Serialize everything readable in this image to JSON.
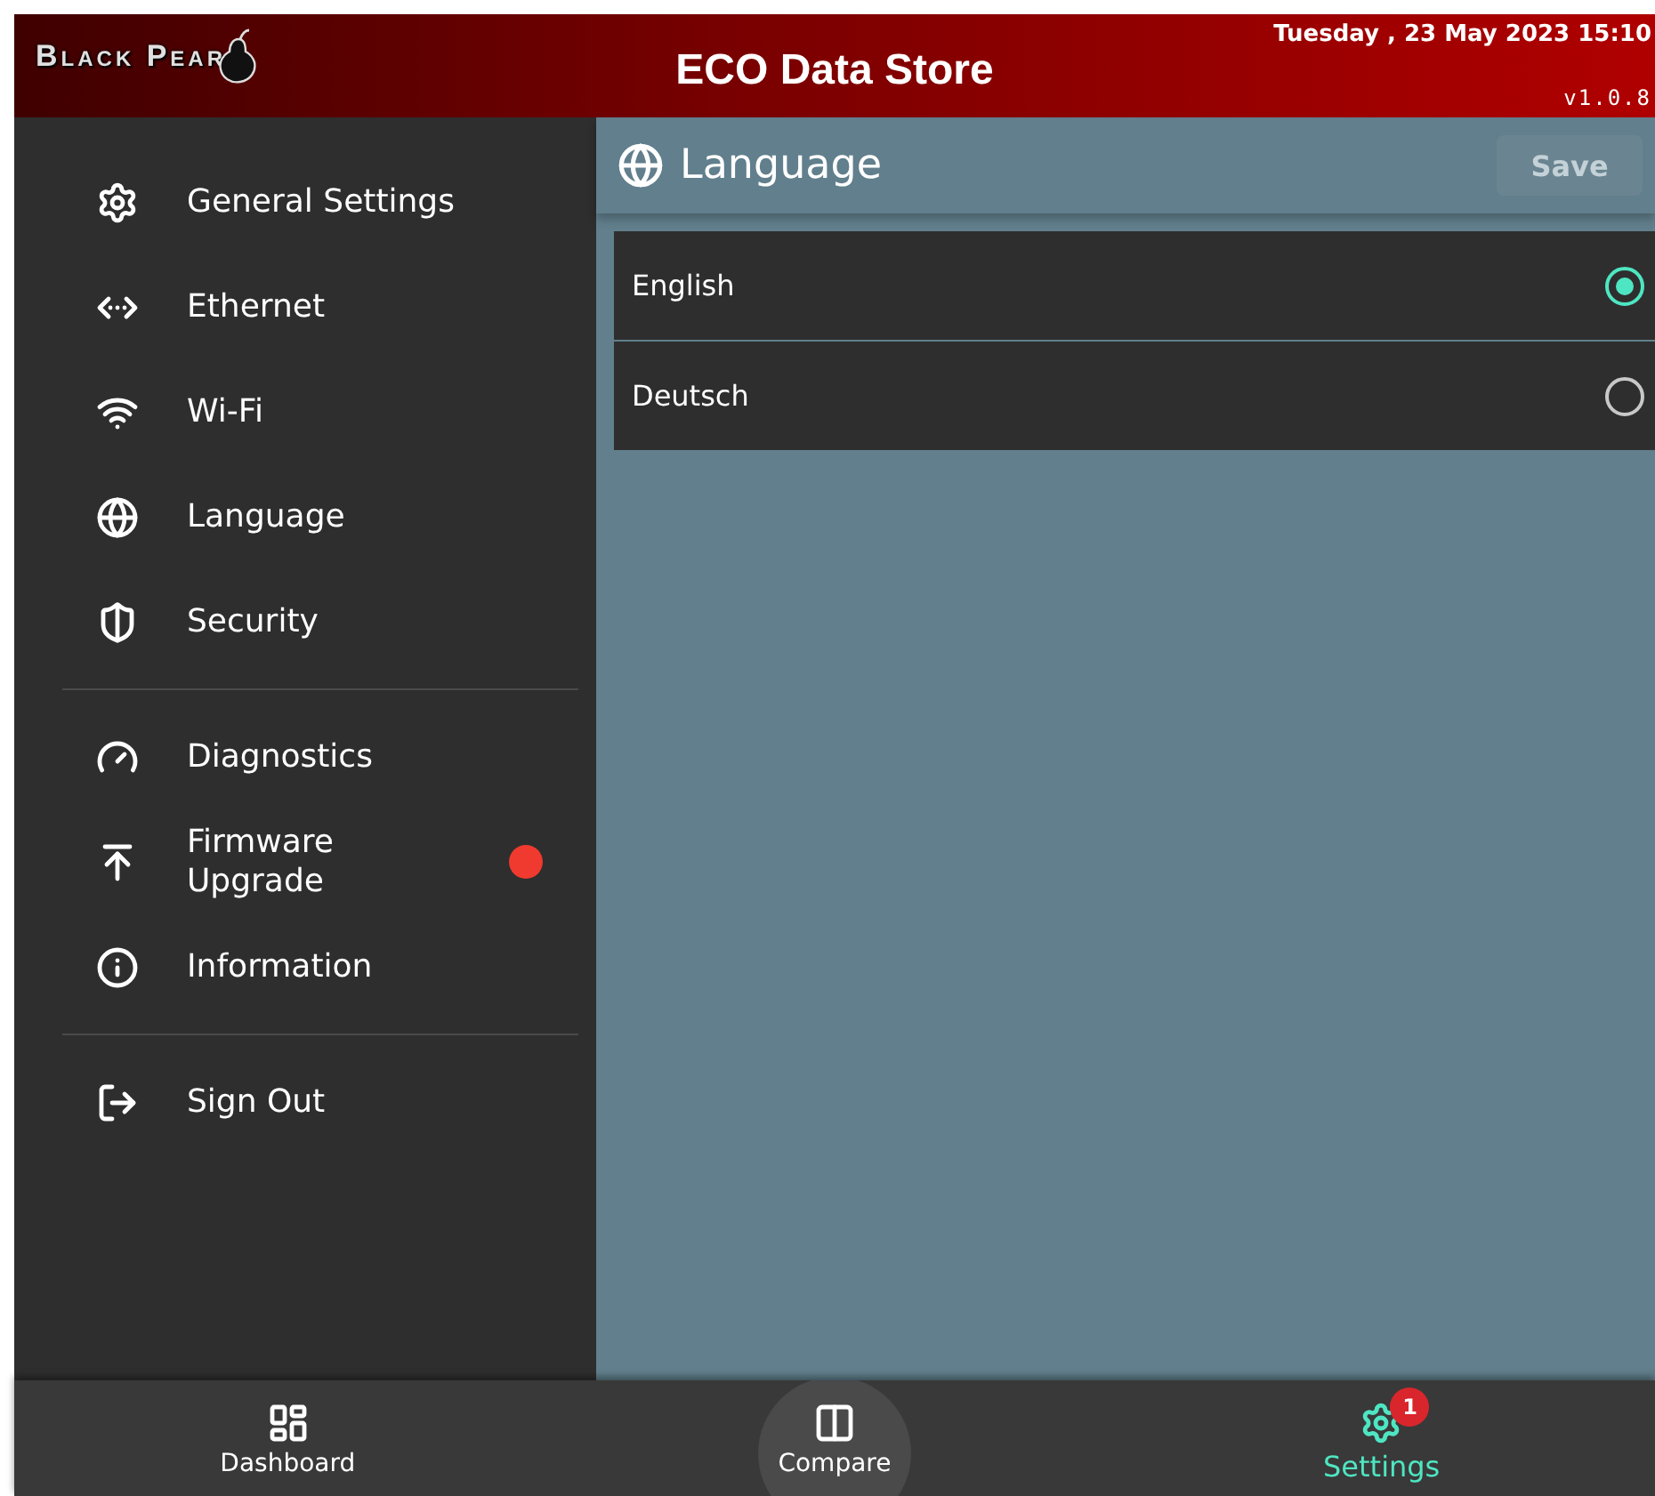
{
  "header": {
    "logo": "Black Pear",
    "title": "ECO Data Store",
    "datetime": "Tuesday , 23 May 2023 15:10",
    "version": "v1.0.8"
  },
  "sidebar": {
    "sections": [
      {
        "items": [
          {
            "label": "General  Settings",
            "alert": false
          },
          {
            "label": "Ethernet",
            "alert": false
          },
          {
            "label": "Wi-Fi",
            "alert": false
          },
          {
            "label": "Language",
            "alert": false
          },
          {
            "label": "Security",
            "alert": false
          }
        ]
      },
      {
        "items": [
          {
            "label": "Diagnostics",
            "alert": false
          },
          {
            "label": "Firmware\nUpgrade",
            "alert": true
          },
          {
            "label": "Information",
            "alert": false
          }
        ]
      },
      {
        "items": [
          {
            "label": "Sign  Out",
            "alert": false
          }
        ]
      }
    ]
  },
  "panel": {
    "title": "Language",
    "save_button": {
      "label": "Save",
      "disabled": true
    },
    "options": [
      {
        "label": "English",
        "selected": true
      },
      {
        "label": "Deutsch",
        "selected": false
      }
    ]
  },
  "bottom_nav": [
    {
      "label": "Dashboard",
      "selected": false,
      "highlighted": false
    },
    {
      "label": "Compare",
      "selected": false,
      "highlighted": true
    },
    {
      "label": "Settings",
      "selected": true,
      "highlighted": false,
      "badge": "1"
    }
  ]
}
